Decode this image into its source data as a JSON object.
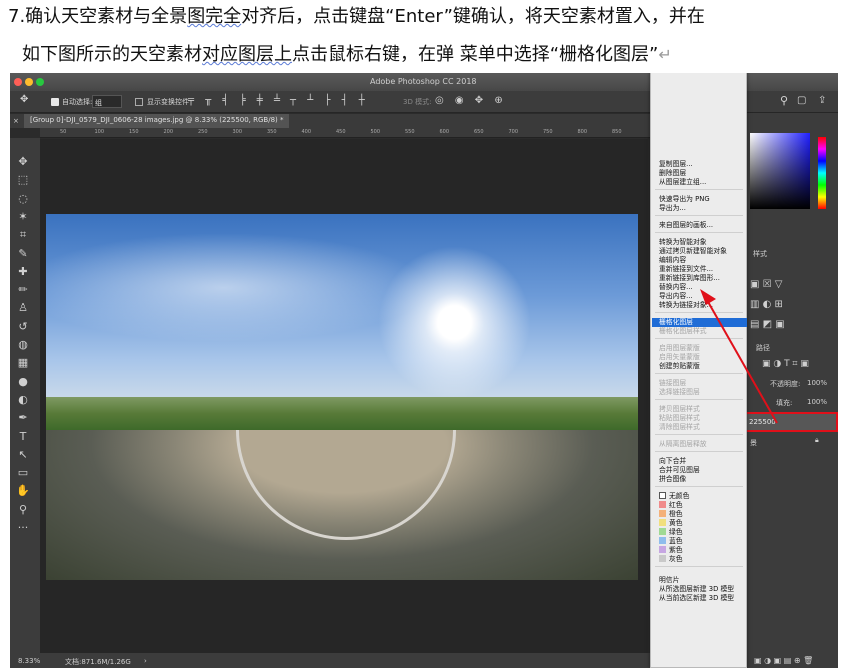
{
  "instruction": {
    "line1_prefix": "7.确认天空素材与全景",
    "line1_wavy": "图完全",
    "line1_suffix": "对齐后，点击键盘“Enter”键确认，将天空素材置入，并在",
    "line2_prefix": "如下图所示的天空素材",
    "line2_wavy": "对应图层上",
    "line2_suffix": "点击鼠标右键，在弹 菜单中选择“栅格化图层”",
    "return_mark": "↵"
  },
  "window": {
    "title": "Adobe Photoshop CC 2018"
  },
  "options_bar": {
    "auto_select_label": "自动选择:",
    "auto_select_value": "组",
    "show_transform_label": "显示变换控件",
    "mode_3d_label": "3D 模式:"
  },
  "document_tab": {
    "label": "[Group 0]-DJI_0579_DJI_0606-28 images.jpg @ 8.33% (225500, RGB/8) *"
  },
  "ruler_ticks": [
    "50",
    "100",
    "150",
    "200",
    "250",
    "300",
    "350",
    "400",
    "450",
    "500",
    "550",
    "600",
    "650",
    "700",
    "750",
    "800",
    "850"
  ],
  "toolbar_icons": [
    "move-icon",
    "marquee-icon",
    "lasso-icon",
    "magic-wand-icon",
    "crop-icon",
    "eyedropper-icon",
    "healing-icon",
    "brush-icon",
    "stamp-icon",
    "history-brush-icon",
    "eraser-icon",
    "gradient-icon",
    "blur-icon",
    "dodge-icon",
    "pen-icon",
    "type-icon",
    "path-select-icon",
    "shape-icon",
    "hand-icon",
    "zoom-icon",
    "more-icon"
  ],
  "toolbar_glyphs": [
    "✥",
    "⬚",
    "◌",
    "✶",
    "⌗",
    "✎",
    "✚",
    "✏",
    "♙",
    "↺",
    "◍",
    "▦",
    "●",
    "◐",
    "✒",
    "T",
    "↖",
    "▭",
    "✋",
    "⚲",
    "···"
  ],
  "status_bar": {
    "zoom": "8.33%",
    "doc_size": "文档:871.6M/1.26G"
  },
  "panels": {
    "style_label": "样式",
    "paths_label": "路径",
    "opacity_label": "不透明度:",
    "opacity_value": "100%",
    "fill_label": "填充:",
    "fill_value": "100%",
    "layer_name": "225500",
    "bg_layer_label": "景"
  },
  "context_menu": {
    "items_top": [
      "复制图层...",
      "删除图层",
      "从图层建立组..."
    ],
    "items_export": [
      "快速导出为 PNG",
      "导出为..."
    ],
    "items_frame": [
      "来自图层的画板..."
    ],
    "items_smart": [
      "转换为智能对象",
      "通过拷贝新建智能对象",
      "编辑内容",
      "重新链接到文件...",
      "重新链接到库图形...",
      "替换内容...",
      "导出内容...",
      "转换为链接对象..."
    ],
    "selected_item": "栅格化图层",
    "items_raster_disabled": [
      "栅格化图层样式"
    ],
    "items_mask_disabled": [
      "启用图层蒙版",
      "启用矢量蒙版"
    ],
    "item_clip": "创建剪贴蒙版",
    "items_link_disabled": [
      "链接图层",
      "选择链接图层"
    ],
    "items_style_disabled": [
      "拷贝图层样式",
      "粘贴图层样式",
      "清除图层样式"
    ],
    "items_isolate_disabled": [
      "从隔离图层释放"
    ],
    "items_merge": [
      "向下合并",
      "合并可见图层",
      "拼合图像"
    ],
    "colors": [
      {
        "label": "无颜色",
        "color": "none"
      },
      {
        "label": "红色",
        "color": "#f08b8b"
      },
      {
        "label": "橙色",
        "color": "#f4b17a"
      },
      {
        "label": "黄色",
        "color": "#f1df7e"
      },
      {
        "label": "绿色",
        "color": "#9fd993"
      },
      {
        "label": "蓝色",
        "color": "#8fbdec"
      },
      {
        "label": "紫色",
        "color": "#c6a6e2"
      },
      {
        "label": "灰色",
        "color": "#c9c9c9"
      }
    ],
    "items_postcard": [
      "明信片",
      "从所选图层新建 3D 模型",
      "从当前选区新建 3D 模型"
    ]
  },
  "colors": {
    "highlight": "#1f6cd6",
    "annotation_red": "#e0101a"
  }
}
